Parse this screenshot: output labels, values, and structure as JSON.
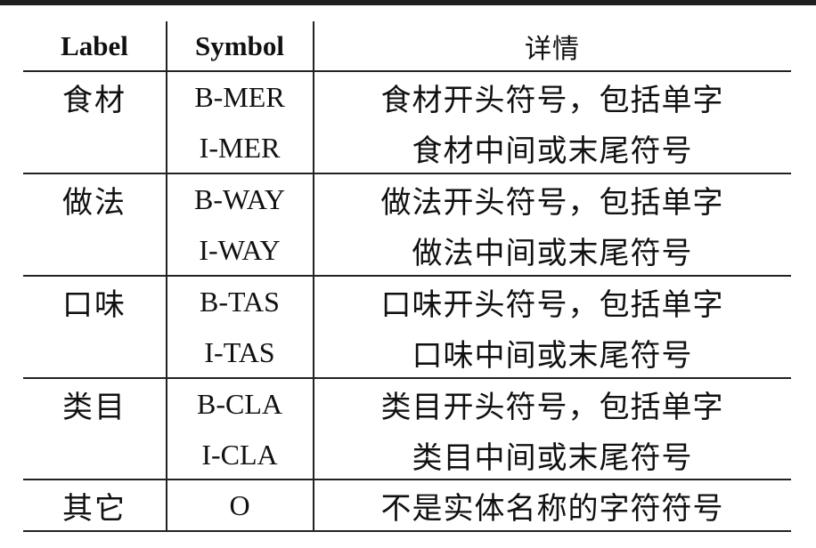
{
  "table": {
    "headers": {
      "label": "Label",
      "symbol": "Symbol",
      "detail": "详情"
    },
    "rows": [
      {
        "label": "食材",
        "symbol": "B-MER",
        "detail": "食材开头符号，包括单字"
      },
      {
        "label": "",
        "symbol": "I-MER",
        "detail": "食材中间或末尾符号"
      },
      {
        "label": "做法",
        "symbol": "B-WAY",
        "detail": "做法开头符号，包括单字"
      },
      {
        "label": "",
        "symbol": "I-WAY",
        "detail": "做法中间或末尾符号"
      },
      {
        "label": "口味",
        "symbol": "B-TAS",
        "detail": "口味开头符号，包括单字"
      },
      {
        "label": "",
        "symbol": "I-TAS",
        "detail": "口味中间或末尾符号"
      },
      {
        "label": "类目",
        "symbol": "B-CLA",
        "detail": "类目开头符号，包括单字"
      },
      {
        "label": "",
        "symbol": "I-CLA",
        "detail": "类目中间或末尾符号"
      },
      {
        "label": "其它",
        "symbol": "O",
        "detail": "不是实体名称的字符符号"
      }
    ]
  }
}
